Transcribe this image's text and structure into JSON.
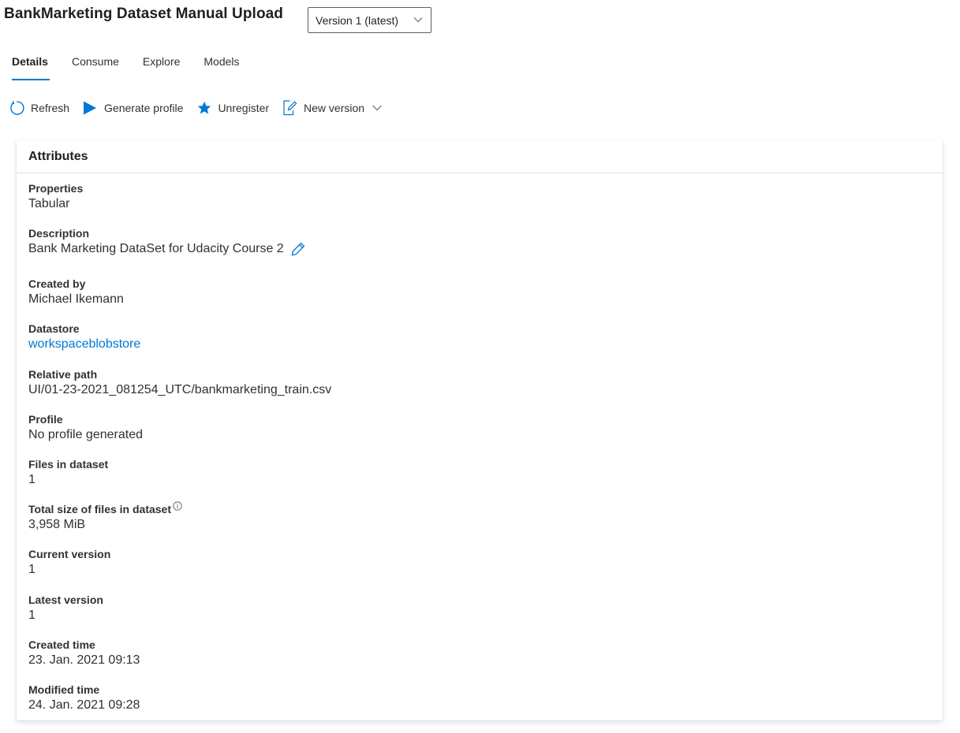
{
  "header": {
    "title": "BankMarketing Dataset Manual Upload",
    "version_select": "Version 1 (latest)"
  },
  "tabs": [
    {
      "label": "Details",
      "active": true
    },
    {
      "label": "Consume",
      "active": false
    },
    {
      "label": "Explore",
      "active": false
    },
    {
      "label": "Models",
      "active": false
    }
  ],
  "toolbar": {
    "refresh": "Refresh",
    "generate_profile": "Generate profile",
    "unregister": "Unregister",
    "new_version": "New version"
  },
  "attributes": {
    "heading": "Attributes",
    "properties": {
      "label": "Properties",
      "value": "Tabular"
    },
    "description": {
      "label": "Description",
      "value": "Bank Marketing DataSet for Udacity Course 2"
    },
    "created_by": {
      "label": "Created by",
      "value": "Michael Ikemann"
    },
    "datastore": {
      "label": "Datastore",
      "value": "workspaceblobstore"
    },
    "relative_path": {
      "label": "Relative path",
      "value": "UI/01-23-2021_081254_UTC/bankmarketing_train.csv"
    },
    "profile": {
      "label": "Profile",
      "value": "No profile generated"
    },
    "files_in_dataset": {
      "label": "Files in dataset",
      "value": "1"
    },
    "total_size": {
      "label": "Total size of files in dataset",
      "value": "3,958 MiB"
    },
    "current_version": {
      "label": "Current version",
      "value": "1"
    },
    "latest_version": {
      "label": "Latest version",
      "value": "1"
    },
    "created_time": {
      "label": "Created time",
      "value": "23. Jan. 2021 09:13"
    },
    "modified_time": {
      "label": "Modified time",
      "value": "24. Jan. 2021 09:28"
    }
  },
  "icons": {
    "refresh": "refresh-icon",
    "generate_profile": "play-icon",
    "unregister": "star-icon",
    "new_version": "edit-document-icon",
    "dropdown": "chevron-down-icon",
    "info": "info-icon",
    "edit": "pencil-icon"
  },
  "colors": {
    "accent": "#0078d4",
    "text": "#323130",
    "border": "#605e5c"
  }
}
